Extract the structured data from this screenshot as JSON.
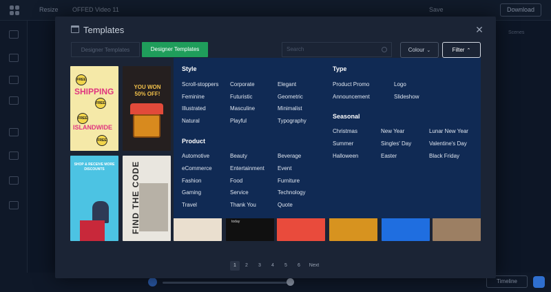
{
  "app": {
    "resize_label": "Resize",
    "doc_title": "OFFED Video 11",
    "save_label": "Save",
    "download_label": "Download",
    "scenes_label": "Scenes",
    "timeline_label": "Timeline"
  },
  "modal": {
    "title": "Templates",
    "tabs": [
      "Designer Templates",
      "Designer Templates"
    ],
    "search_placeholder": "Search",
    "colour_label": "Colour",
    "filter_label": "Filter"
  },
  "thumbs": {
    "shipping": "SHIPPING",
    "islandwide": "ISLANDWIDE",
    "free": "FREE",
    "won": "YOU WON 50% OFF!",
    "shop": "SHOP & RECEIVE MORE DISCOUNTS",
    "find_code": "FIND THE CODE",
    "today": "today"
  },
  "filters": {
    "style": {
      "title": "Style",
      "options": [
        "Scroll-stoppers",
        "Corporate",
        "Elegant",
        "Feminine",
        "Futuristic",
        "Geometric",
        "Illustrated",
        "Masculine",
        "Minimalist",
        "Natural",
        "Playful",
        "Typography"
      ]
    },
    "type": {
      "title": "Type",
      "options": [
        "Product Promo",
        "Logo",
        "Announcement",
        "Slideshow"
      ]
    },
    "product": {
      "title": "Product",
      "options": [
        "Automotive",
        "Beauty",
        "Beverage",
        "eCommerce",
        "Entertainment",
        "Event",
        "Fashion",
        "Food",
        "Furniture",
        "Gaming",
        "Service",
        "Technology",
        "Travel",
        "Thank You",
        "Quote"
      ]
    },
    "seasonal": {
      "title": "Seasonal",
      "options": [
        "Christmas",
        "New Year",
        "Lunar New Year",
        "Summer",
        "Singles' Day",
        "Valentine's Day",
        "Halloween",
        "Easter",
        "Black Friday"
      ]
    }
  },
  "pagination": {
    "pages": [
      "1",
      "2",
      "3",
      "4",
      "5",
      "6"
    ],
    "active": "1",
    "next_label": "Next"
  },
  "colors": {
    "accent_green": "#1f9d5b",
    "panel_blue": "#102a54",
    "modal_bg": "#1b2435"
  }
}
